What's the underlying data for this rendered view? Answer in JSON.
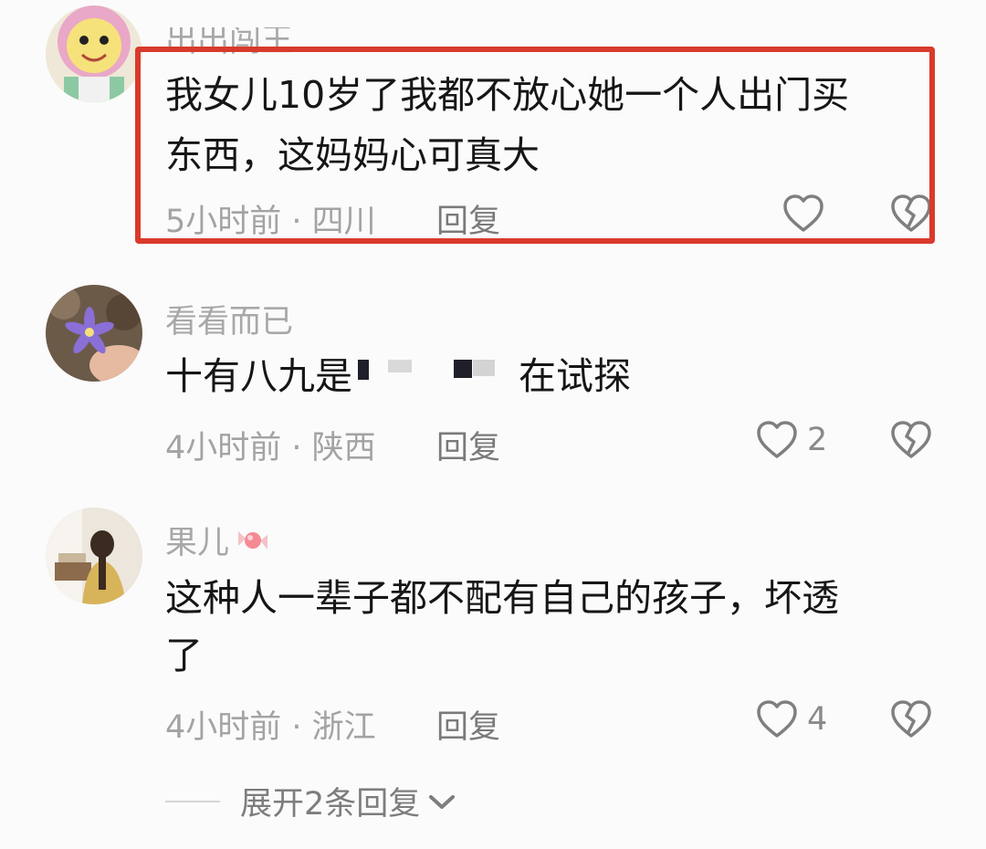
{
  "comments": [
    {
      "username": "出出闯王",
      "text_lines": [
        "我女儿10岁了我都不放心她一个人出门买",
        "东西，这妈妈心可真大"
      ],
      "meta": "5小时前 · 四川",
      "reply_label": "回复",
      "like_count": "",
      "highlighted": true
    },
    {
      "username": "看看而已",
      "text_lines": [
        "十有八九是",
        "在试探"
      ],
      "meta": "4小时前 · 陕西",
      "reply_label": "回复",
      "like_count": "2"
    },
    {
      "username": "果儿",
      "text_lines": [
        "这种人一辈子都不配有自己的孩子，坏透",
        "了"
      ],
      "meta": "4小时前 · 浙江",
      "reply_label": "回复",
      "like_count": "4"
    }
  ],
  "expand_replies": {
    "label": "展开2条回复"
  },
  "icons": {
    "like": "heart-outline-icon",
    "dislike": "broken-heart-icon",
    "expand": "chevron-down-icon",
    "emoji": "candy-emoji-icon"
  },
  "colors": {
    "highlight_border": "#d93a2b",
    "text": "#161616",
    "secondary": "#a3a3a3"
  }
}
